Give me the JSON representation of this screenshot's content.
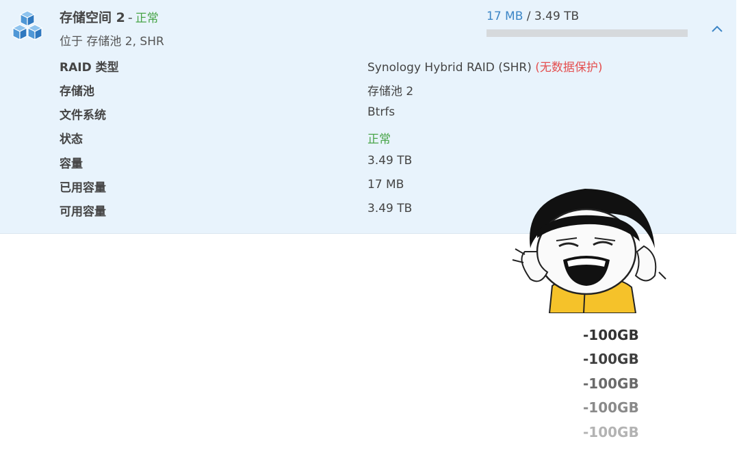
{
  "volume": {
    "title": "存储空间 2",
    "separator": "-",
    "status_inline": "正常",
    "location": "位于 存储池 2, SHR",
    "usage_used": "17 MB",
    "usage_sep": " / ",
    "usage_total": "3.49 TB",
    "usage_fraction": 5e-06,
    "icon": "volume-cubes-icon",
    "collapse_icon": "chevron-up-icon"
  },
  "details": [
    {
      "key": "RAID 类型",
      "value": "Synology Hybrid RAID (SHR)",
      "note": "(无数据保护)"
    },
    {
      "key": "存储池",
      "value": "存储池 2"
    },
    {
      "key": "文件系统",
      "value": "Btrfs"
    },
    {
      "key": "状态",
      "value": "正常"
    },
    {
      "key": "容量",
      "value": "3.49 TB"
    },
    {
      "key": "已用容量",
      "value": "17 MB"
    },
    {
      "key": "可用容量",
      "value": "3.49 TB"
    }
  ],
  "meme": {
    "icon": "laughing-face-sticker-icon",
    "lines": [
      "-100GB",
      "-100GB",
      "-100GB",
      "-100GB",
      "-100GB"
    ]
  },
  "colors": {
    "panel_bg": "#e8f3fc",
    "accent": "#3d86c6",
    "ok": "#47a447",
    "warn": "#e44f4f"
  }
}
